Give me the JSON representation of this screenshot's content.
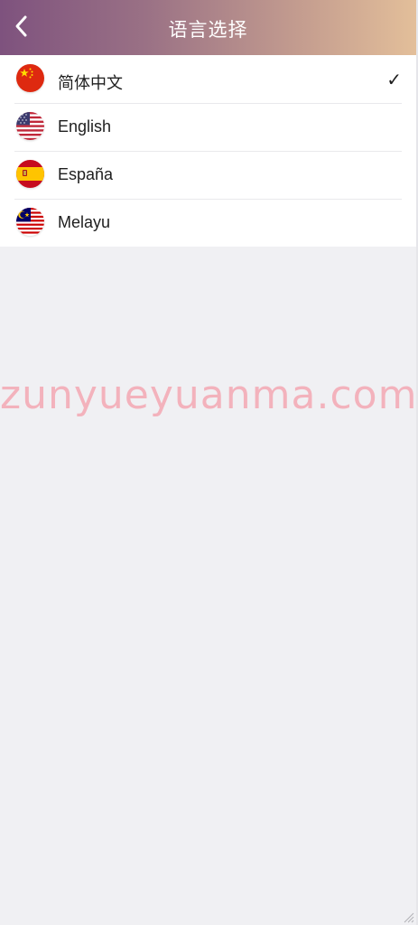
{
  "header": {
    "title": "语言选择",
    "back_icon": "chevron-left-icon",
    "gradient_start": "#7e527e",
    "gradient_end": "#e3bf9a"
  },
  "languages": [
    {
      "label": "简体中文",
      "flag": "china-flag-icon",
      "selected": true
    },
    {
      "label": "English",
      "flag": "usa-flag-icon",
      "selected": false
    },
    {
      "label": "España",
      "flag": "spain-flag-icon",
      "selected": false
    },
    {
      "label": "Melayu",
      "flag": "malaysia-flag-icon",
      "selected": false
    }
  ],
  "selected_mark": "✓",
  "watermark": "zunyueyuanma.com",
  "colors": {
    "background": "#f0f0f3",
    "watermark": "#f4a8b3"
  }
}
